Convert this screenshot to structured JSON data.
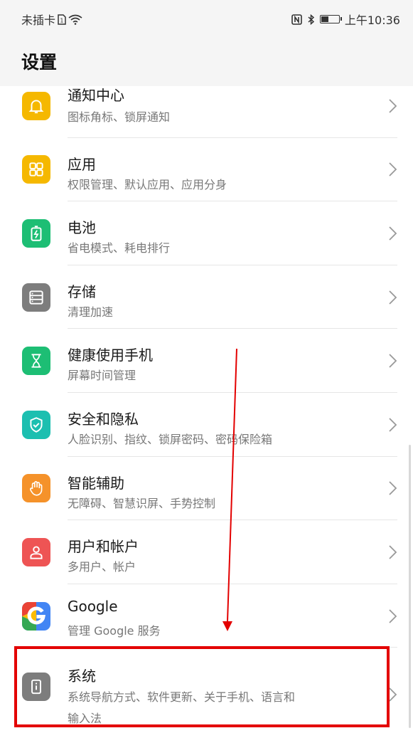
{
  "status_bar": {
    "carrier": "未插卡",
    "sim_icon": "sim-card-icon",
    "wifi_icon": "wifi-icon",
    "nfc_icon": "nfc-icon",
    "bluetooth_icon": "bluetooth-icon",
    "battery_level": 0.45,
    "time": "上午10:36"
  },
  "header": {
    "title": "设置"
  },
  "items": [
    {
      "title": "通知中心",
      "subtitle": "图标角标、锁屏通知",
      "icon": "bell-icon",
      "color": "#F5B800"
    },
    {
      "title": "应用",
      "subtitle": "权限管理、默认应用、应用分身",
      "icon": "apps-grid-icon",
      "color": "#F5B800"
    },
    {
      "title": "电池",
      "subtitle": "省电模式、耗电排行",
      "icon": "battery-icon",
      "color": "#1DBE74"
    },
    {
      "title": "存储",
      "subtitle": "清理加速",
      "icon": "storage-icon",
      "color": "#7D7D7D"
    },
    {
      "title": "健康使用手机",
      "subtitle": "屏幕时间管理",
      "icon": "hourglass-icon",
      "color": "#1DBE74"
    },
    {
      "title": "安全和隐私",
      "subtitle": "人脸识别、指纹、锁屏密码、密码保险箱",
      "icon": "shield-icon",
      "color": "#1CBFB0"
    },
    {
      "title": "智能辅助",
      "subtitle": "无障碍、智慧识屏、手势控制",
      "icon": "hand-icon",
      "color": "#F5922A"
    },
    {
      "title": "用户和帐户",
      "subtitle": "多用户、帐户",
      "icon": "user-icon",
      "color": "#EE5454"
    },
    {
      "title": "Google",
      "subtitle": "管理 Google 服务",
      "icon": "google-icon",
      "color": "#4285F4"
    },
    {
      "title": "系统",
      "subtitle_line1": "系统导航方式、软件更新、关于手机、语言和",
      "subtitle_line2": "输入法",
      "icon": "phone-info-icon",
      "color": "#7D7D7D"
    }
  ],
  "annotation": {
    "highlight_color": "#E30000"
  }
}
